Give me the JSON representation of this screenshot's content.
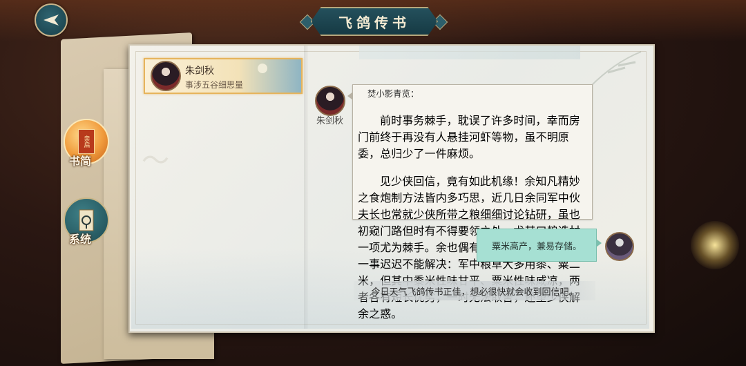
{
  "title": "飞鸽传书",
  "nav": {
    "letters_label": "书简",
    "letters_badge": "亲启",
    "system_label": "系统"
  },
  "contact": {
    "name": "朱剑秋",
    "subtitle": "事涉五谷细思量"
  },
  "message": {
    "sender": "朱剑秋",
    "greeting": "焚小影青览：",
    "paragraphs": [
      "前时事务棘手，耽误了许多时间，幸而房门前终于再没有人悬挂河虾等物，虽不明原委，总归少了一件麻烦。",
      "见少侠回信，竟有如此机缘！余知凡精妙之食炮制方法皆内多巧思，近几日余同军中伙夫长也常就少侠所带之粮细细讨论钻研，虽也初窥门路但时有不得要领之处，尤其口粮选材一项尤为棘手。余也偶有些尝试心得，但唯有一事迟迟不能解决：军中粮草大多用黍、粟二米，但其中黍米性味甘平、粟米性味咸凉，两者各有短长优劣，一时无法取舍，还望少侠解余之惑。"
    ]
  },
  "reply": {
    "text": "粟米高产，兼易存储。"
  },
  "notice": "今日天气飞鸽传书正佳，想必很快就会收到回信吧。",
  "colors": {
    "accent_teal": "#1d4b53",
    "reply_bubble": "#a6e0d3",
    "selected_border": "#e6b45c"
  }
}
